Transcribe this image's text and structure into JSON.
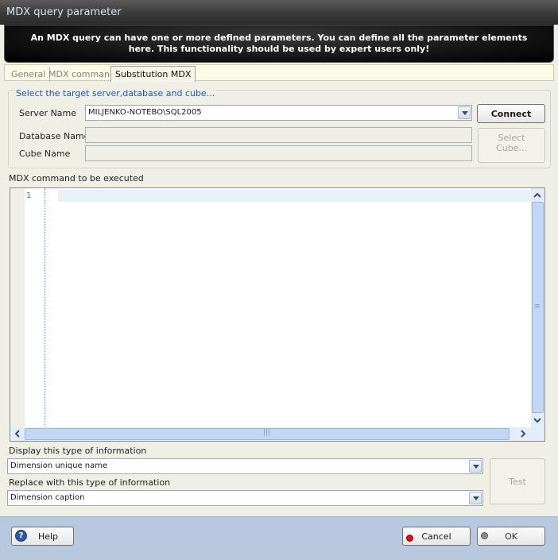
{
  "window": {
    "title": "MDX query parameter"
  },
  "banner": {
    "message": "An MDX query can have one or more defined parameters. You can define all the parameter elements here. This functionality should be used by expert users only!"
  },
  "tabs": [
    {
      "label": "General"
    },
    {
      "label": "MDX command"
    },
    {
      "label": "Substitution MDX",
      "active": true
    }
  ],
  "target": {
    "group_title": "Select the target server,database and cube...",
    "server_label": "Server Name",
    "server_value": "MILJENKO-NOTEBO\\SQL2005",
    "database_label": "Database Name",
    "database_value": "",
    "cube_label": "Cube Name",
    "cube_value": "",
    "connect_label": "Connect",
    "select_cube_label": "Select Cube..."
  },
  "editor": {
    "label": "MDX command to be executed",
    "line_number": "1",
    "content": ""
  },
  "display": {
    "label": "Display this type of information",
    "value": "Dimension unique name"
  },
  "replace": {
    "label": "Replace with this type of information",
    "value": "Dimension caption"
  },
  "test_label": "Test",
  "footer": {
    "help_label": "Help",
    "cancel_label": "Cancel",
    "ok_label": "OK"
  },
  "icons": {
    "help": "help-icon",
    "cancel": "red-dot-icon",
    "ok": "gray-dot-icon"
  }
}
